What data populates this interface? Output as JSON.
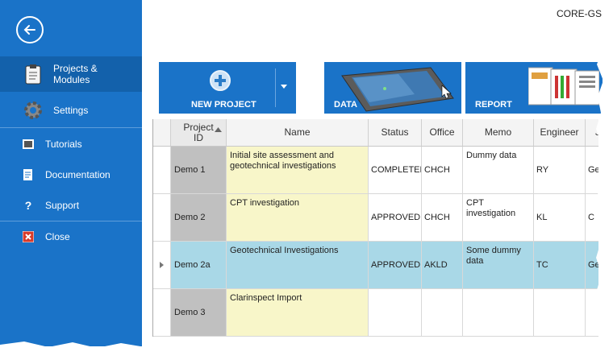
{
  "sidebar": {
    "items": [
      {
        "label": "Projects &\nModules",
        "icon": "clipboard-icon"
      },
      {
        "label": "Settings",
        "icon": "gear-icon"
      },
      {
        "label": "Tutorials",
        "icon": "film-icon"
      },
      {
        "label": "Documentation",
        "icon": "document-icon"
      },
      {
        "label": "Support",
        "icon": "question-icon"
      },
      {
        "label": "Close",
        "icon": "close-icon"
      }
    ]
  },
  "header": {
    "title": "CORE-GS"
  },
  "tiles": {
    "new_project": "NEW PROJECT",
    "data": "DATA",
    "report": "REPORT"
  },
  "table": {
    "columns": [
      "Project\nID",
      "Name",
      "Status",
      "Office",
      "Memo",
      "Engineer",
      "J"
    ],
    "rows": [
      {
        "id": "Demo 1",
        "name": "Initial site assessment and geotechnical investigations",
        "status": "COMPLETED",
        "office": "CHCH",
        "memo": "Dummy data",
        "engineer": "RY",
        "extra": "Ger"
      },
      {
        "id": "Demo 2",
        "name": "CPT investigation",
        "status": "APPROVED",
        "office": "CHCH",
        "memo": "CPT investigation",
        "engineer": "KL",
        "extra": "C"
      },
      {
        "id": "Demo 2a",
        "name": "Geotechnical Investigations",
        "status": "APPROVED",
        "office": "AKLD",
        "memo": "Some dummy data",
        "engineer": "TC",
        "extra": "Geo"
      },
      {
        "id": "Demo 3",
        "name": "Clarinspect Import",
        "status": "",
        "office": "",
        "memo": "",
        "engineer": "",
        "extra": ""
      }
    ]
  },
  "colors": {
    "sidebar": "#1a73c8",
    "active": "#1361ab",
    "selected_row": "#a9d8e7",
    "name_cell": "#f8f6c9",
    "id_cell": "#c0c0c0"
  }
}
